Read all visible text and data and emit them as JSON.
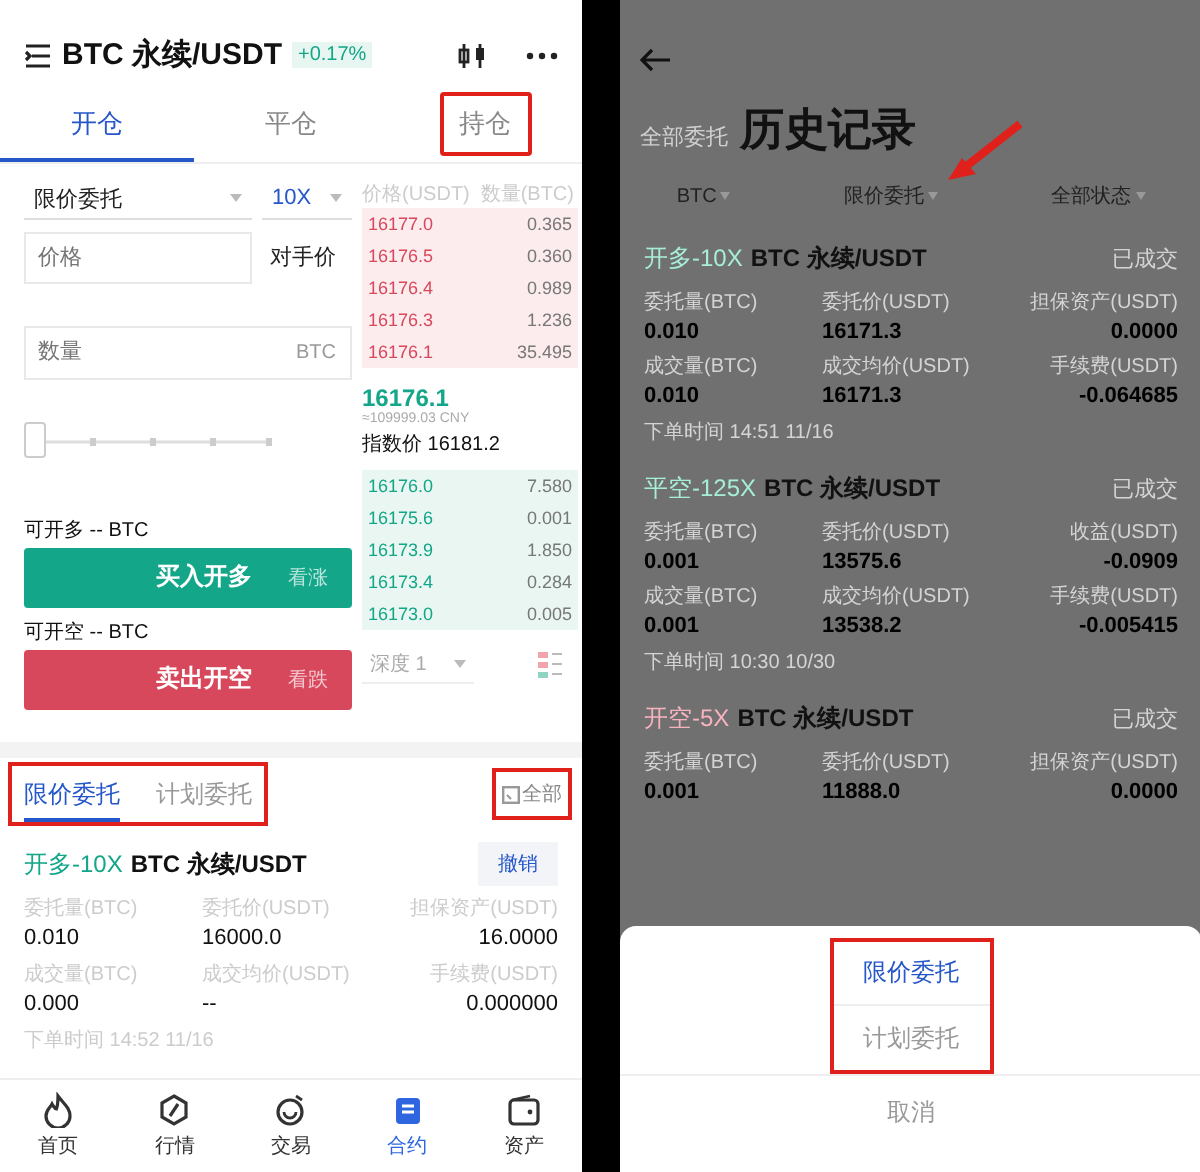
{
  "left": {
    "title": "BTC 永续/USDT",
    "change": "+0.17%",
    "tabs": [
      {
        "label": "开仓",
        "selected": true,
        "annotated": false
      },
      {
        "label": "平仓",
        "selected": false,
        "annotated": false
      },
      {
        "label": "持仓",
        "selected": false,
        "annotated": true
      }
    ],
    "order_type": "限价委托",
    "leverage": "10X",
    "price": {
      "placeholder": "价格"
    },
    "counter_price": "对手价",
    "quantity": {
      "placeholder": "数量",
      "unit": "BTC"
    },
    "slider": {
      "level": 0
    },
    "actions": [
      {
        "color": "#13a689",
        "available": "可开多 -- BTC",
        "button": "买入开多",
        "hint": "看涨"
      },
      {
        "color": "#d8485c",
        "available": "可开空 -- BTC",
        "button": "卖出开空",
        "hint": "看跌"
      }
    ],
    "order_book": {
      "columns": [
        "价格(USDT)",
        "数量(BTC)"
      ],
      "asks": [
        {
          "price": "16177.0",
          "amount": "0.365"
        },
        {
          "price": "16176.5",
          "amount": "0.360"
        },
        {
          "price": "16176.4",
          "amount": "0.989"
        },
        {
          "price": "16176.3",
          "amount": "1.236"
        },
        {
          "price": "16176.1",
          "amount": "35.495"
        }
      ],
      "last_price": "16176.1",
      "cny": "≈109999.03 CNY",
      "index_price": "指数价 16181.2",
      "bids": [
        {
          "price": "16176.0",
          "amount": "7.580"
        },
        {
          "price": "16175.6",
          "amount": "0.001"
        },
        {
          "price": "16173.9",
          "amount": "1.850"
        },
        {
          "price": "16173.4",
          "amount": "0.284"
        },
        {
          "price": "16173.0",
          "amount": "0.005"
        }
      ],
      "depth": "深度 1"
    },
    "order_tabs": {
      "annotated": true,
      "items": [
        {
          "label": "限价委托",
          "selected": true
        },
        {
          "label": "计划委托",
          "selected": false
        }
      ]
    },
    "all_button": {
      "label": "全部",
      "annotated": true
    },
    "order": {
      "color": "#13a689",
      "side": "开多-10X",
      "pair": "BTC 永续/USDT",
      "cancel": "撤销",
      "fields": [
        {
          "label": "委托量(BTC)",
          "value": "0.010"
        },
        {
          "label": "委托价(USDT)",
          "value": "16000.0"
        },
        {
          "label": "担保资产(USDT)",
          "value": "16.0000"
        },
        {
          "label": "成交量(BTC)",
          "value": "0.000"
        },
        {
          "label": "成交均价(USDT)",
          "value": "--"
        },
        {
          "label": "手续费(USDT)",
          "value": "0.000000"
        }
      ],
      "time": "下单时间 14:52 11/16"
    },
    "nav": [
      {
        "kind": "home",
        "label": "首页",
        "selected": false
      },
      {
        "kind": "market",
        "label": "行情",
        "selected": false
      },
      {
        "kind": "trade",
        "label": "交易",
        "selected": false
      },
      {
        "kind": "contract",
        "label": "合约",
        "selected": true
      },
      {
        "kind": "assets",
        "label": "资产",
        "selected": false
      }
    ]
  },
  "right": {
    "filter_title": "全部委托",
    "overlay_title": "历史记录",
    "filters": [
      "BTC",
      "限价委托",
      "全部状态"
    ],
    "records": [
      {
        "color": "#a6eed8",
        "side": "开多-10X",
        "pair": "BTC 永续/USDT",
        "status": "已成交",
        "fields": [
          {
            "label": "委托量(BTC)",
            "value": "0.010"
          },
          {
            "label": "委托价(USDT)",
            "value": "16171.3"
          },
          {
            "label": "担保资产(USDT)",
            "value": "0.0000"
          },
          {
            "label": "成交量(BTC)",
            "value": "0.010"
          },
          {
            "label": "成交均价(USDT)",
            "value": "16171.3"
          },
          {
            "label": "手续费(USDT)",
            "value": "-0.064685"
          }
        ],
        "time": "下单时间 14:51 11/16"
      },
      {
        "color": "#a6eed8",
        "side": "平空-125X",
        "pair": "BTC 永续/USDT",
        "status": "已成交",
        "fields": [
          {
            "label": "委托量(BTC)",
            "value": "0.001"
          },
          {
            "label": "委托价(USDT)",
            "value": "13575.6"
          },
          {
            "label": "收益(USDT)",
            "value": "-0.0909"
          },
          {
            "label": "成交量(BTC)",
            "value": "0.001"
          },
          {
            "label": "成交均价(USDT)",
            "value": "13538.2"
          },
          {
            "label": "手续费(USDT)",
            "value": "-0.005415"
          }
        ],
        "time": "下单时间 10:30 10/30"
      },
      {
        "color": "#f6b3bd",
        "side": "开空-5X",
        "pair": "BTC 永续/USDT",
        "status": "已成交",
        "fields": [
          {
            "label": "委托量(BTC)",
            "value": "0.001"
          },
          {
            "label": "委托价(USDT)",
            "value": "11888.0"
          },
          {
            "label": "担保资产(USDT)",
            "value": "0.0000"
          }
        ]
      }
    ],
    "sheet": {
      "annotated": true,
      "options": [
        {
          "label": "限价委托",
          "selected": true
        },
        {
          "label": "计划委托",
          "selected": false
        }
      ],
      "cancel": "取消"
    }
  }
}
